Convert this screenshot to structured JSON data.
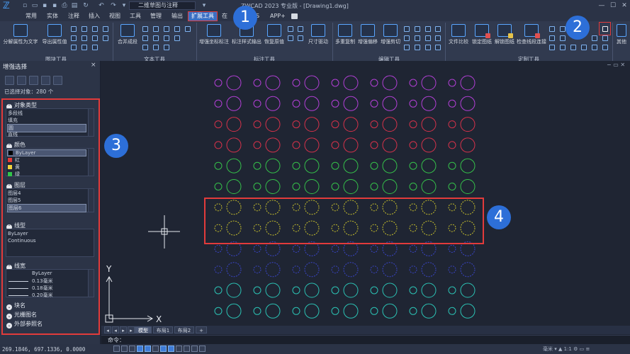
{
  "app": {
    "title": "ZWCAD 2023 专业版 - [Drawing1.dwg]",
    "workspace": "二维草图与注释"
  },
  "menu": {
    "items": [
      "常用",
      "实体",
      "注释",
      "插入",
      "视图",
      "工具",
      "管理",
      "输出",
      "扩展工具",
      "在",
      "S",
      "APP+"
    ],
    "active_index": 8
  },
  "ribbon": {
    "buttons": {
      "export_text": "分解属性为文字",
      "export_attr": "导出属性值",
      "merge_text": "合并成段",
      "enh_coord": "增强坐标标注",
      "dim_style": "标注样式输出",
      "restore_dim": "恢复原值",
      "dim_drive": "尺寸驱动",
      "multi_copy": "多重复制",
      "enh_offset": "增强偏移",
      "enh_trim": "增强剪切",
      "file_compare": "文件比较",
      "lock_drawing": "锁定图纸",
      "unlock_drawing": "解锁图纸",
      "check_lines": "检查线段连接",
      "other": "其他"
    },
    "panels": [
      "图块工具",
      "文本工具",
      "标注工具",
      "编辑工具",
      "定制工具"
    ]
  },
  "palette": {
    "title": "增强选择",
    "close": "×",
    "selected_count": "已选择对象：280 个",
    "object_type": {
      "heading": "对象类型",
      "items": [
        "多段线",
        "填充",
        "圆",
        "直线"
      ],
      "selected_index": 2
    },
    "color": {
      "heading": "颜色",
      "items": [
        "ByLayer",
        "红",
        "黄",
        "绿"
      ],
      "swatches": [
        "#000000",
        "#e53935",
        "#f2d43c",
        "#31c44a"
      ],
      "selected_index": 0
    },
    "layer": {
      "heading": "图层",
      "items": [
        "图层4",
        "图层5",
        "图层6"
      ],
      "selected_index": 2
    },
    "linetype": {
      "heading": "线型",
      "items": [
        "ByLayer",
        "Continuous"
      ]
    },
    "lineweight": {
      "heading": "线宽",
      "items": [
        "ByLayer",
        "0.13毫米",
        "0.18毫米",
        "0.20毫米"
      ]
    },
    "collapsed": [
      "块名",
      "光栅图名",
      "外部参照名"
    ]
  },
  "drawing": {
    "row_colors": [
      "#b23fd6",
      "#b23fd6",
      "#d6324a",
      "#d6324a",
      "#35c04a",
      "#35c04a",
      "#c9c22c",
      "#c9c22c",
      "#3a45c9",
      "#3a45c9",
      "#2bc2b4",
      "#2bc2b4"
    ],
    "dashed_rows": [
      6,
      7,
      8,
      9
    ],
    "axis_y": "Y",
    "axis_x": "X"
  },
  "tabs": {
    "items": [
      "模型",
      "布局1",
      "布局2",
      "+"
    ],
    "active_index": 0
  },
  "command": {
    "label": "命令："
  },
  "status": {
    "coords": "269.1846, 697.1336, 0.0000",
    "unit": "毫米",
    "scale": "1:1"
  },
  "callouts": [
    "1",
    "2",
    "3",
    "4"
  ]
}
